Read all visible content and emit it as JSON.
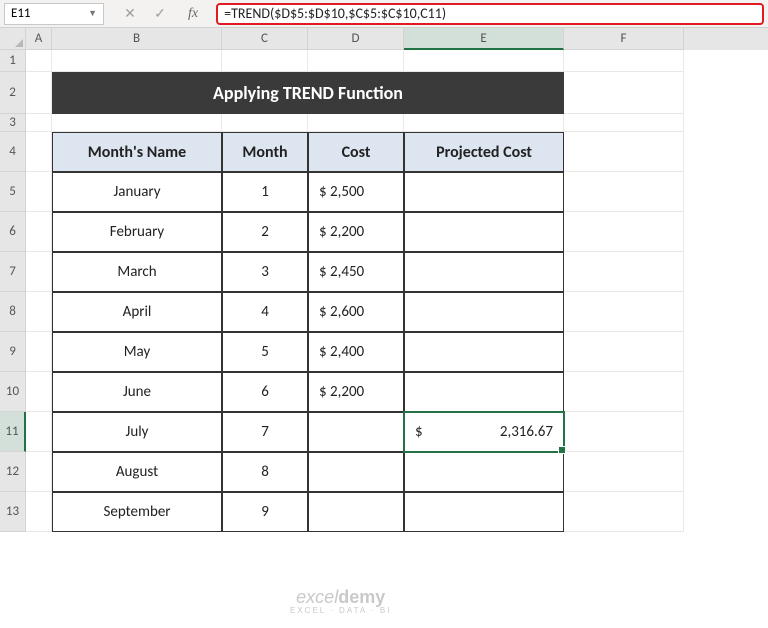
{
  "formula_bar": {
    "name_box": "E11",
    "cancel_icon": "✕",
    "enter_icon": "✓",
    "fx_label": "fx",
    "formula": "=TREND($D$5:$D$10,$C$5:$C$10,C11)"
  },
  "columns": [
    "",
    "A",
    "B",
    "C",
    "D",
    "E",
    "F"
  ],
  "selected_col": "E",
  "row_heads": [
    "1",
    "2",
    "3",
    "4",
    "5",
    "6",
    "7",
    "8",
    "9",
    "10",
    "11",
    "12",
    "13"
  ],
  "selected_row": "11",
  "title": "Applying TREND Function",
  "headers": {
    "b": "Month's Name",
    "c": "Month",
    "d": "Cost",
    "e": "Projected Cost"
  },
  "rows": [
    {
      "name": "January",
      "month": "1",
      "cost": "$  2,500",
      "proj": ""
    },
    {
      "name": "February",
      "month": "2",
      "cost": "$  2,200",
      "proj": ""
    },
    {
      "name": "March",
      "month": "3",
      "cost": "$  2,450",
      "proj": ""
    },
    {
      "name": "April",
      "month": "4",
      "cost": "$  2,600",
      "proj": ""
    },
    {
      "name": "May",
      "month": "5",
      "cost": "$  2,400",
      "proj": ""
    },
    {
      "name": "June",
      "month": "6",
      "cost": "$  2,200",
      "proj": ""
    },
    {
      "name": "July",
      "month": "7",
      "cost": "",
      "proj_dollar": "$",
      "proj_val": "2,316.67"
    },
    {
      "name": "August",
      "month": "8",
      "cost": "",
      "proj": ""
    },
    {
      "name": "September",
      "month": "9",
      "cost": "",
      "proj": ""
    }
  ],
  "watermark": {
    "l1a": "excel",
    "l1b": "demy",
    "l2": "EXCEL · DATA · BI"
  }
}
